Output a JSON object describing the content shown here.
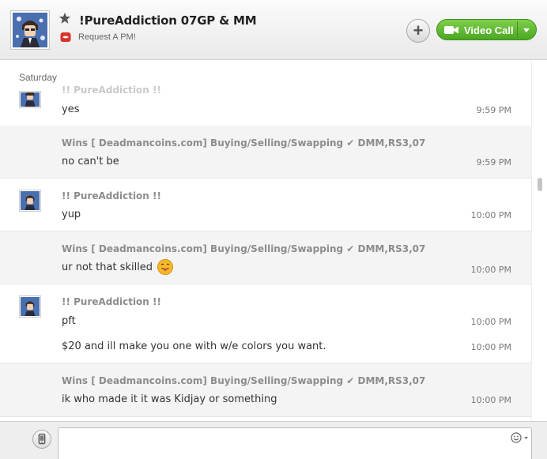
{
  "header": {
    "contact_name": "!PureAddiction 07GP & MM",
    "mood": "Request A PM!",
    "video_call_label": "Video Call",
    "icons": {
      "favorite": "star-icon",
      "mood": "lips-icon",
      "add": "plus-icon",
      "video": "camera-icon"
    }
  },
  "conversation": {
    "day": "Saturday",
    "messages": [
      {
        "sender": "!! PureAddiction !!",
        "text": "yes",
        "time": "9:59 PM"
      },
      {
        "sender": "Wins [ Deadmancoins.com] Buying/Selling/Swapping ✔ DMM,RS3,07",
        "text": "no can't be",
        "time": "9:59 PM"
      },
      {
        "sender": "!! PureAddiction !!",
        "text": "yup",
        "time": "10:00 PM"
      },
      {
        "sender": "Wins [ Deadmancoins.com] Buying/Selling/Swapping ✔ DMM,RS3,07",
        "text": "ur not that skilled",
        "time": "10:00 PM",
        "emoji": "tongue-out-emoji"
      },
      {
        "sender": "!! PureAddiction !!",
        "text": "pft",
        "time": "10:00 PM",
        "text2": "$20 and ill make you one with w/e colors you want.",
        "time2": "10:00 PM"
      },
      {
        "sender": "Wins [ Deadmancoins.com] Buying/Selling/Swapping ✔ DMM,RS3,07",
        "text": "ik who made it it was  Kidjay or something",
        "time": "10:00 PM"
      }
    ]
  },
  "compose": {
    "placeholder": "",
    "value": "",
    "icons": {
      "mobile": "mobile-phone-icon",
      "emoticon": "smiley-icon"
    }
  },
  "colors": {
    "video_green": "#5cb82e",
    "sender_gray": "#8c8c8c",
    "alt_row": "#f4f4f4"
  }
}
